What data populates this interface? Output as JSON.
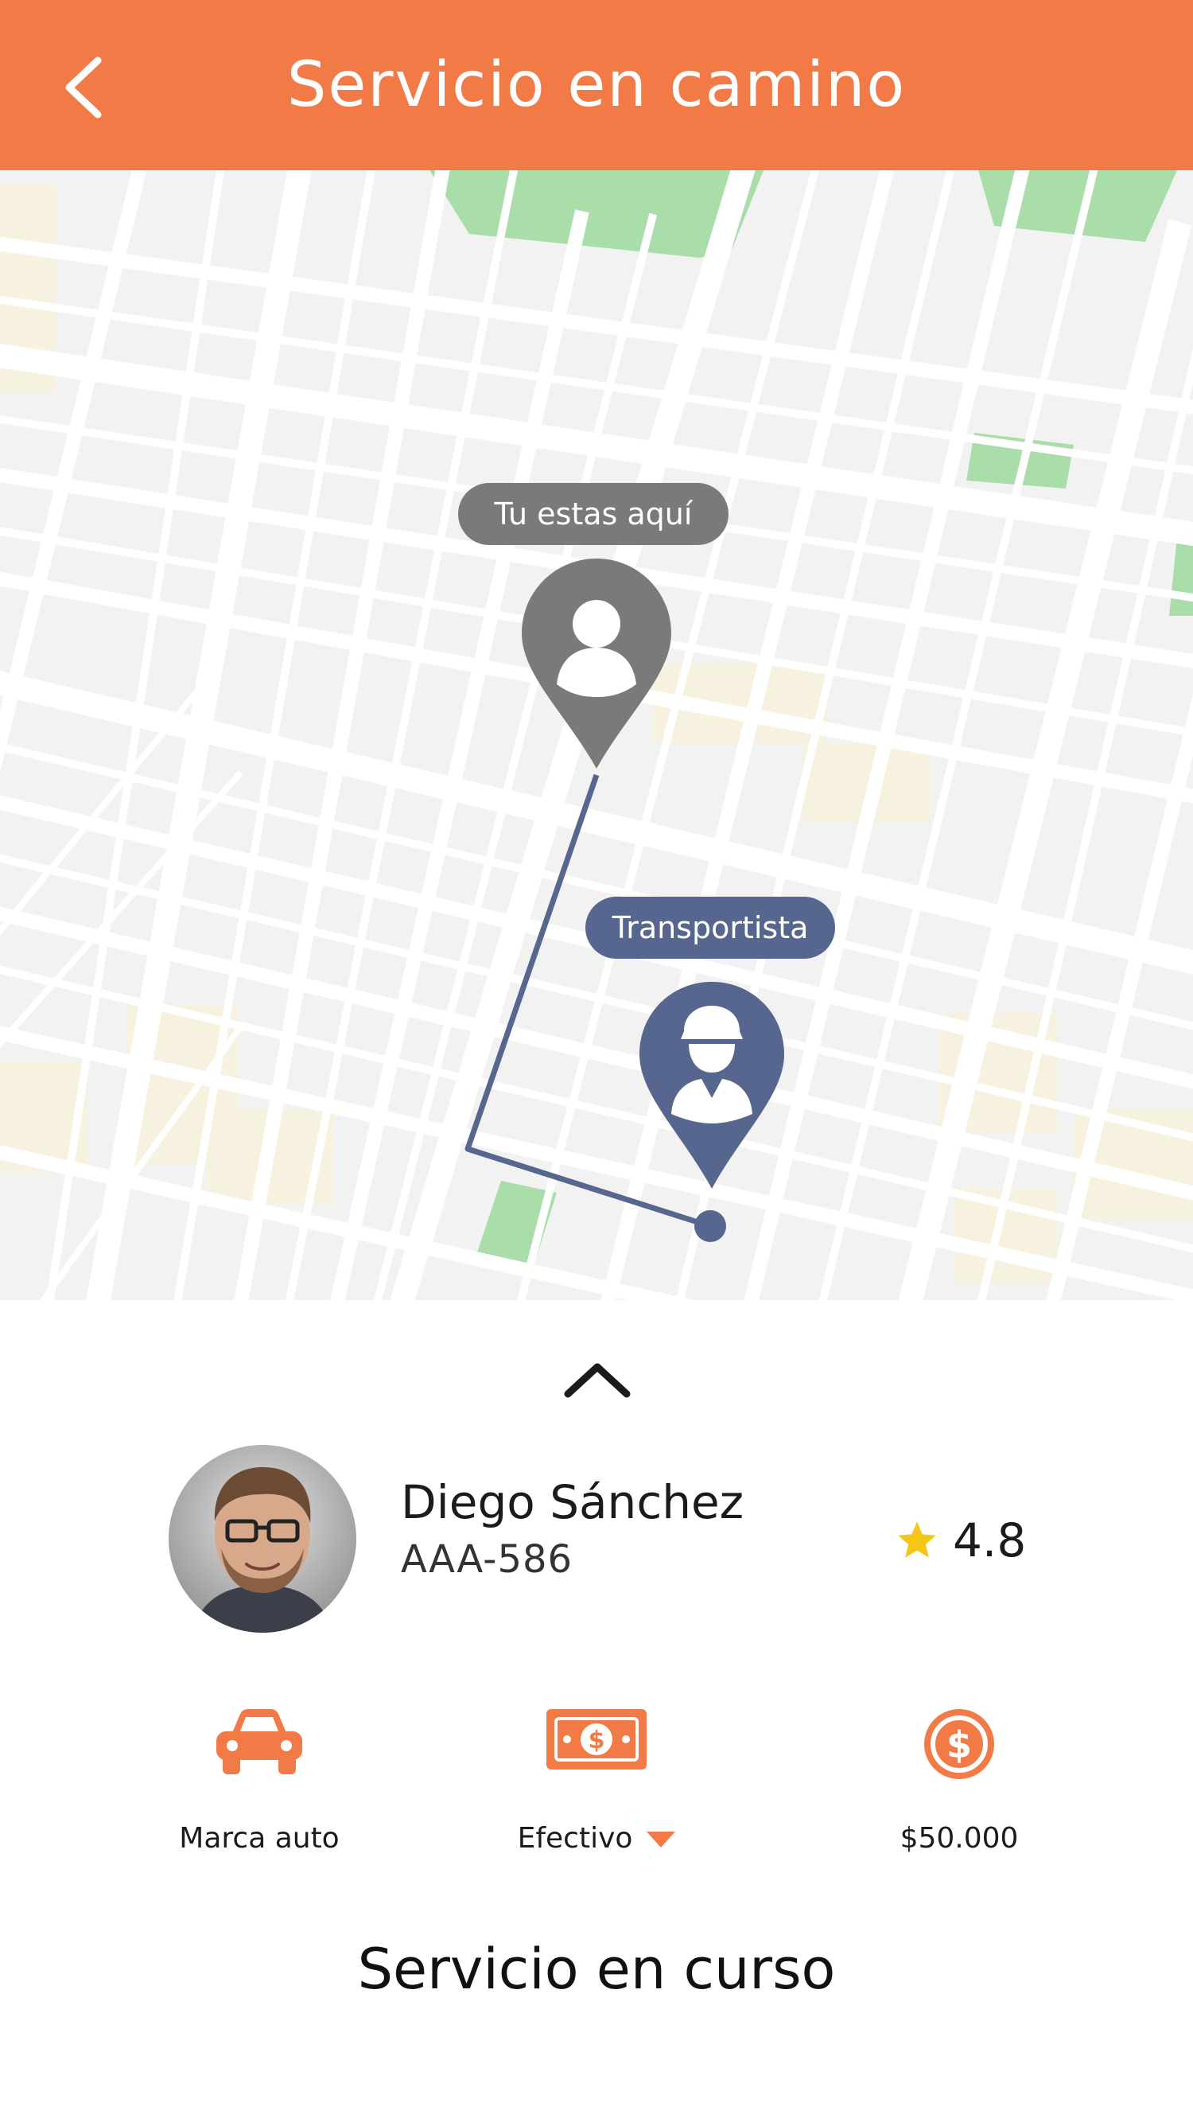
{
  "header": {
    "title": "Servicio en camino",
    "back_icon": "chevron-left-icon"
  },
  "map": {
    "user_label": "Tu estas aquí",
    "driver_label": "Transportista",
    "colors": {
      "user_pin": "#7A7A7A",
      "driver_pin": "#56668E",
      "route": "#56668E"
    }
  },
  "driver": {
    "name": "Diego Sánchez",
    "plate": "AAA-586",
    "rating": "4.8",
    "rating_icon": "star-icon"
  },
  "details": {
    "car_label": "Marca auto",
    "payment_label": "Efectivo",
    "price_label": "$50.000"
  },
  "status_text": "Servicio en curso",
  "colors": {
    "accent": "#F17A47",
    "star": "#F5C518"
  }
}
